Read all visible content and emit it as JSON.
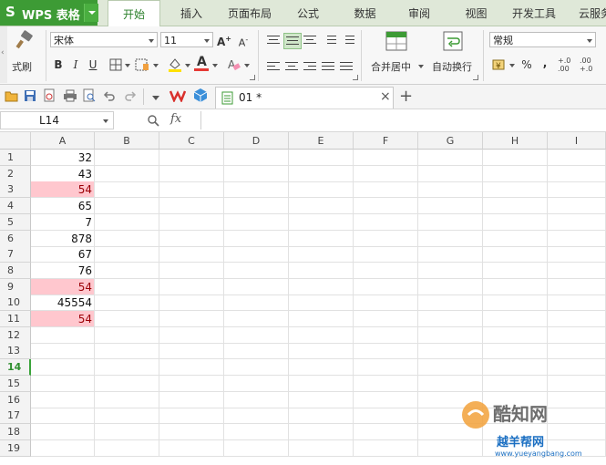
{
  "app": {
    "title": "WPS 表格",
    "logo": "S"
  },
  "tabs": [
    {
      "label": "开始",
      "active": true
    },
    {
      "label": "插入"
    },
    {
      "label": "页面布局"
    },
    {
      "label": "公式"
    },
    {
      "label": "数据"
    },
    {
      "label": "审阅"
    },
    {
      "label": "视图"
    },
    {
      "label": "开发工具"
    },
    {
      "label": "云服务"
    }
  ],
  "ribbon": {
    "format_painter_label": "式刷",
    "font_name": "宋体",
    "font_size": "11",
    "bold": "B",
    "italic": "I",
    "underline": "U",
    "font_color_glyph": "A",
    "merge_label": "合并居中",
    "wrap_label": "自动换行",
    "number_format": "常规",
    "percent": "%",
    "comma": ",",
    "inc_decimal_top": "+.0",
    "inc_decimal_bottom": ".00",
    "dec_decimal_top": ".00",
    "dec_decimal_bottom": "+.0",
    "accent_color": "#3d9b35",
    "font_color_bar": "#e53935",
    "fill_color_bar": "#ffe100"
  },
  "document": {
    "tab_label": "01 *",
    "close_glyph": "×",
    "new_tab_glyph": "+"
  },
  "formula_bar": {
    "name_box": "L14",
    "fx": "fx",
    "value": ""
  },
  "columns": [
    "A",
    "B",
    "C",
    "D",
    "E",
    "F",
    "G",
    "H",
    "I"
  ],
  "rows": [
    {
      "num": "1",
      "a": "32",
      "hl": false
    },
    {
      "num": "2",
      "a": "43",
      "hl": false
    },
    {
      "num": "3",
      "a": "54",
      "hl": true
    },
    {
      "num": "4",
      "a": "65",
      "hl": false
    },
    {
      "num": "5",
      "a": "7",
      "hl": false
    },
    {
      "num": "6",
      "a": "878",
      "hl": false
    },
    {
      "num": "7",
      "a": "67",
      "hl": false
    },
    {
      "num": "8",
      "a": "76",
      "hl": false
    },
    {
      "num": "9",
      "a": "54",
      "hl": true
    },
    {
      "num": "10",
      "a": "45554",
      "hl": false
    },
    {
      "num": "11",
      "a": "54",
      "hl": true
    },
    {
      "num": "12",
      "a": "",
      "hl": false
    },
    {
      "num": "13",
      "a": "",
      "hl": false
    },
    {
      "num": "14",
      "a": "",
      "hl": false,
      "selected": true
    },
    {
      "num": "15",
      "a": "",
      "hl": false
    },
    {
      "num": "16",
      "a": "",
      "hl": false
    },
    {
      "num": "17",
      "a": "",
      "hl": false
    },
    {
      "num": "18",
      "a": "",
      "hl": false
    },
    {
      "num": "19",
      "a": "",
      "hl": false
    }
  ],
  "watermark": {
    "brand": "酷知网",
    "site_name": "越羊帮网",
    "url": "www.yueyangbang.com"
  }
}
